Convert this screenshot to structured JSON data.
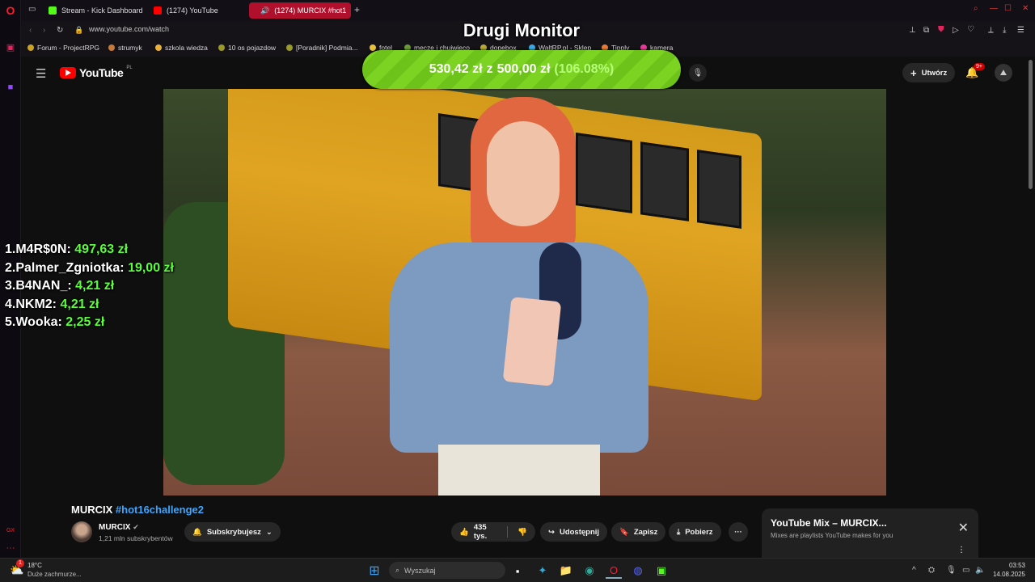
{
  "tabs": [
    {
      "label": "Stream - Kick Dashboard",
      "color": "#53fc18"
    },
    {
      "label": "(1274) YouTube",
      "color": "#ff0000"
    },
    {
      "label": "(1274) MURCIX #hot1",
      "color": "#ff0000",
      "active": true
    }
  ],
  "address": {
    "url": "www.youtube.com/watch"
  },
  "bookmarks": [
    "Forum - ProjectRPG",
    "strumyk",
    "szkola wiedza",
    "10 os pojazdow",
    "[Poradnik] Podmia...",
    "fotel",
    "mecze i chujwieco",
    "dopebox",
    "WaltRP.pl - Sklep",
    "Tipply",
    "kamera"
  ],
  "youtube": {
    "logo_text": "YouTube",
    "logo_region": "PL",
    "create_label": "Utwórz",
    "notif_badge": "9+"
  },
  "overlay": {
    "title": "Drugi Monitor",
    "goal_current": "530,42 zł",
    "goal_sep": "z",
    "goal_target": "500,00 zł",
    "goal_percent": "(106.08%)",
    "goal_fraction": 1.0608
  },
  "leaderboard": [
    {
      "rank": "1.",
      "name": "M4R$0N:",
      "amount": "497,63 zł"
    },
    {
      "rank": "2.",
      "name": "Palmer_Zgniotka:",
      "amount": "19,00 zł"
    },
    {
      "rank": "3.",
      "name": "B4NAN_:",
      "amount": "4,21 zł"
    },
    {
      "rank": "4.",
      "name": "NKM2:",
      "amount": "4,21 zł"
    },
    {
      "rank": "5.",
      "name": "Wooka:",
      "amount": "2,25 zł"
    }
  ],
  "video": {
    "title_main": "MURCIX",
    "title_tag": "#hot16challenge2",
    "channel_name": "MURCIX",
    "channel_subs": "1,21 mln subskrybentów",
    "subscribe_label": "Subskrybujesz",
    "likes": "435 tys.",
    "share_label": "Udostępnij",
    "save_label": "Zapisz",
    "download_label": "Pobierz"
  },
  "mix": {
    "title": "YouTube Mix – MURCIX...",
    "subtitle": "Mixes are playlists YouTube makes for you"
  },
  "taskbar": {
    "weather_temp": "18°C",
    "weather_desc": "Duże zachmurze...",
    "search_placeholder": "Wyszukaj",
    "time": "03:53",
    "date": "14.08.2025",
    "notif_count": "1"
  }
}
